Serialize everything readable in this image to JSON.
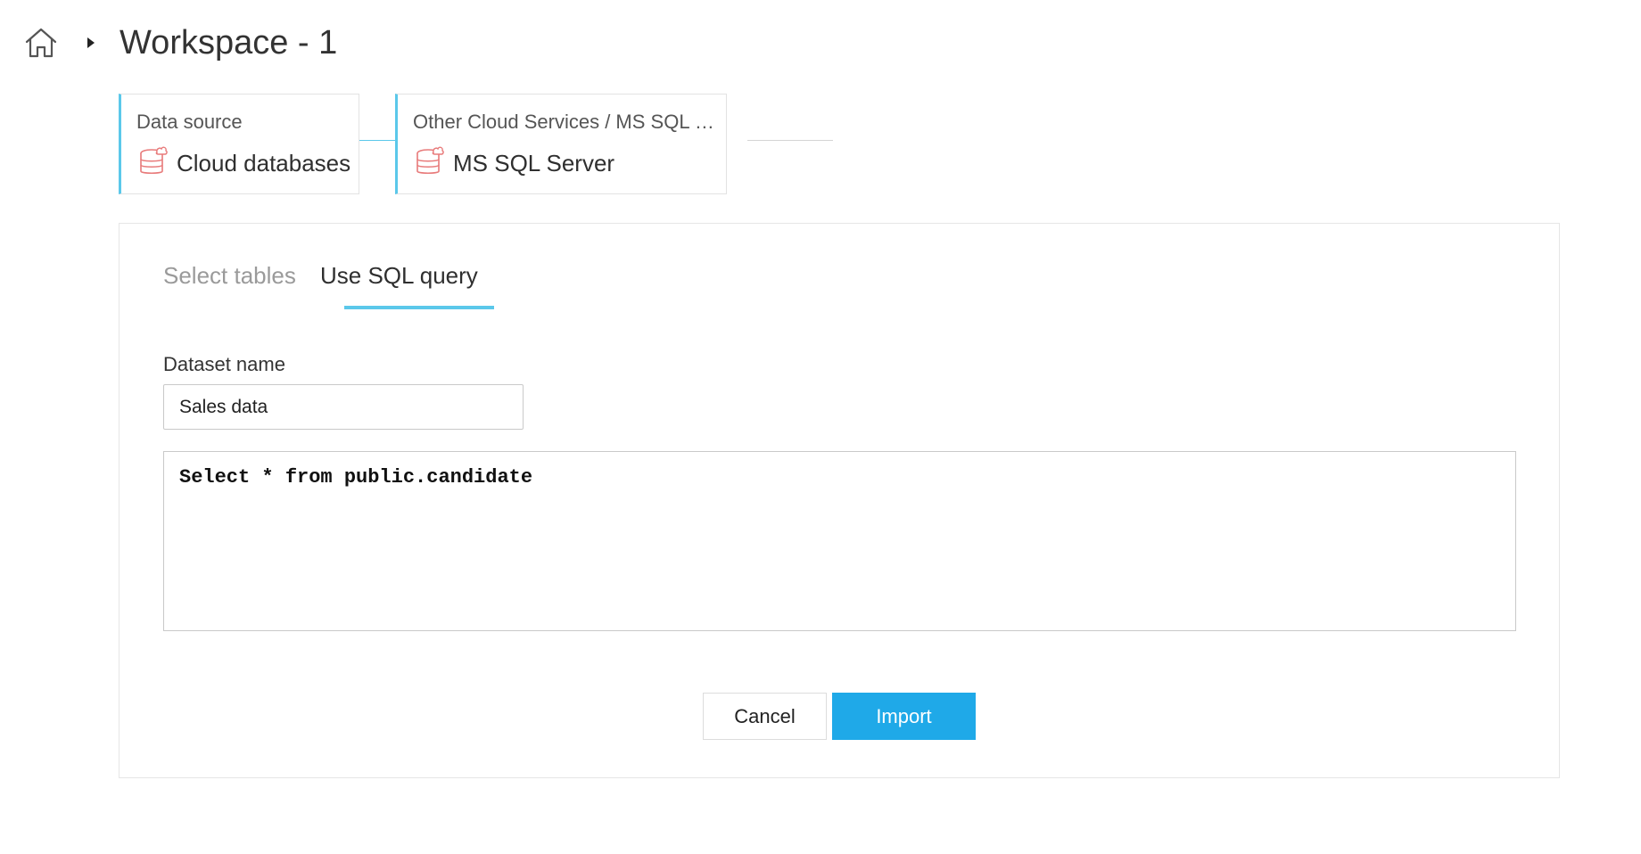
{
  "header": {
    "title": "Workspace - 1",
    "home_icon": "home-icon",
    "breadcrumb_icon": "caret-right-icon"
  },
  "steps": [
    {
      "label": "Data source",
      "value": "Cloud databases",
      "icon": "cloud-database-icon"
    },
    {
      "label": "Other Cloud Services / MS SQL S...",
      "value": "MS SQL Server",
      "icon": "cloud-database-icon"
    }
  ],
  "tabs": [
    {
      "label": "Select tables",
      "active": false
    },
    {
      "label": "Use SQL query",
      "active": true
    }
  ],
  "form": {
    "dataset_label": "Dataset name",
    "dataset_value": "Sales data",
    "sql_query": "Select * from public.candidate"
  },
  "buttons": {
    "cancel": "Cancel",
    "import": "Import"
  },
  "colors": {
    "accent": "#5bc8ea",
    "primary_button": "#1fa9e8",
    "icon_database": "#e87a7a"
  }
}
